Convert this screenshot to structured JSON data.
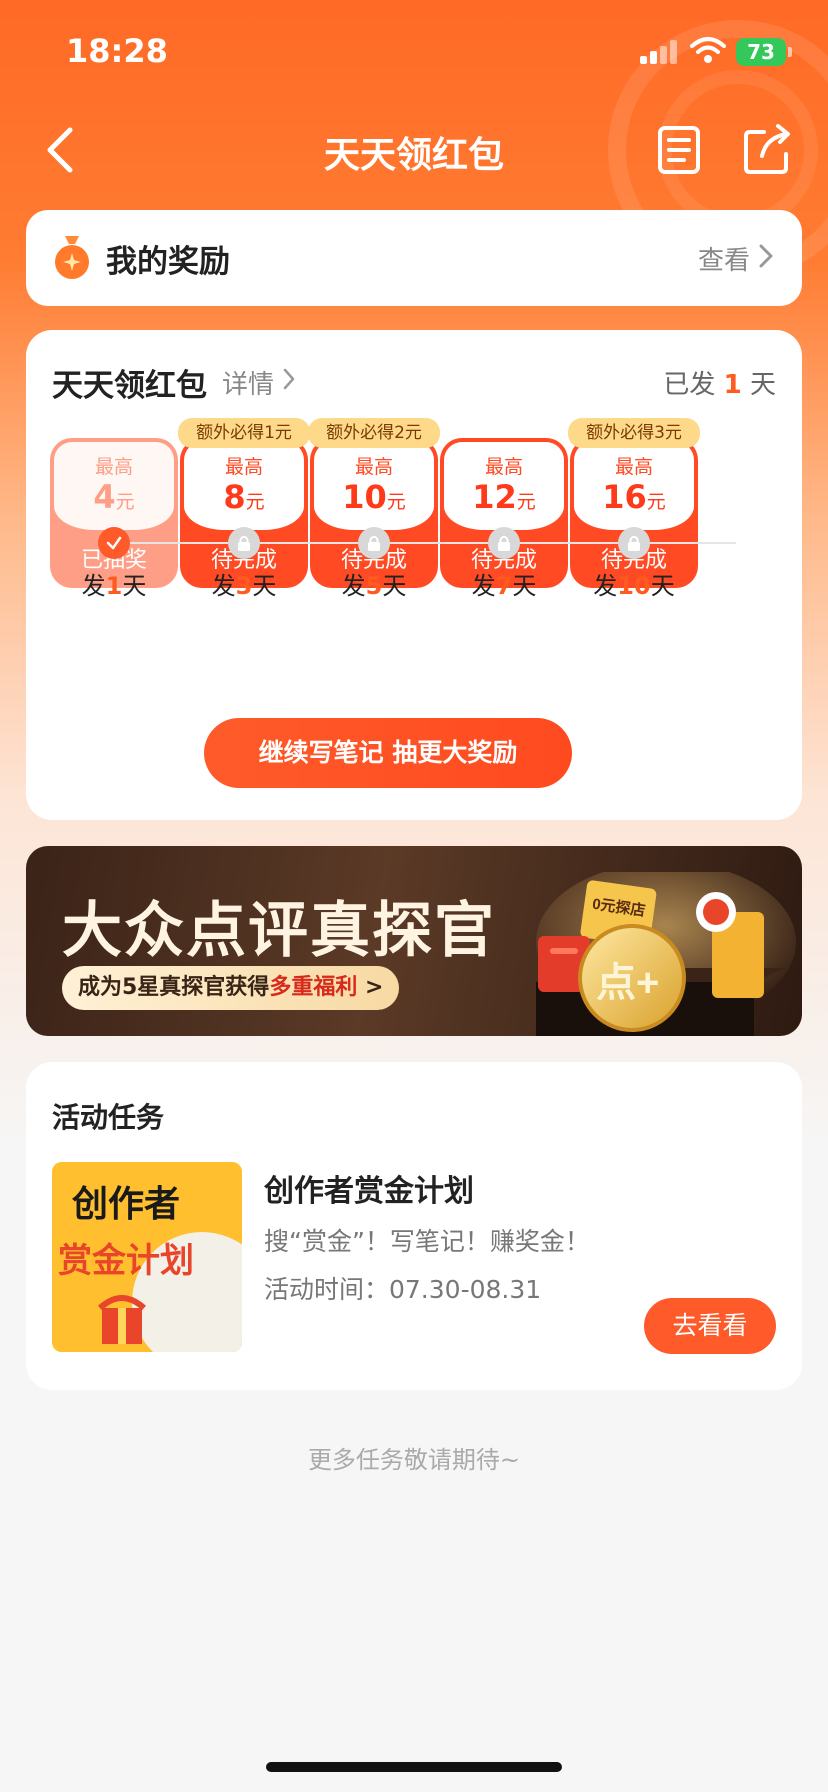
{
  "status": {
    "time": "18:28",
    "battery": "73"
  },
  "nav": {
    "title": "天天领红包"
  },
  "reward": {
    "title": "我的奖励",
    "view_label": "查看"
  },
  "packet": {
    "title": "天天领红包",
    "detail_label": "详情",
    "sent_prefix": "已发",
    "sent_days": "1",
    "sent_suffix": "天",
    "tiles": [
      {
        "badge": "",
        "max": "最高",
        "amount": "4",
        "unit": "元",
        "status": "已抽奖"
      },
      {
        "badge": "额外必得1元",
        "max": "最高",
        "amount": "8",
        "unit": "元",
        "status": "待完成"
      },
      {
        "badge": "额外必得2元",
        "max": "最高",
        "amount": "10",
        "unit": "元",
        "status": "待完成"
      },
      {
        "badge": "",
        "max": "最高",
        "amount": "12",
        "unit": "元",
        "status": "待完成"
      },
      {
        "badge": "额外必得3元",
        "max": "最高",
        "amount": "16",
        "unit": "元",
        "status": "待完成"
      }
    ],
    "days": [
      {
        "prefix": "发",
        "num": "1",
        "suffix": "天"
      },
      {
        "prefix": "发",
        "num": "3",
        "suffix": "天"
      },
      {
        "prefix": "发",
        "num": "5",
        "suffix": "天"
      },
      {
        "prefix": "发",
        "num": "7",
        "suffix": "天"
      },
      {
        "prefix": "发",
        "num": "10",
        "suffix": "天"
      }
    ],
    "cta": "继续写笔记 抽更大奖励"
  },
  "banner": {
    "title": "大众点评真探官",
    "sub_prefix": "成为5星真探官获得",
    "sub_highlight": "多重福利",
    "sub_arrow": ">",
    "art_text": "0元探店",
    "coin_text": "点+"
  },
  "tasks": {
    "heading": "活动任务",
    "items": [
      {
        "thumb_line1": "创作者",
        "thumb_line2": "赏金计划",
        "name": "创作者赏金计划",
        "desc": "搜“赏金”！写笔记！赚奖金！",
        "time": "活动时间：07.30-08.31",
        "button": "去看看"
      }
    ]
  },
  "more_tip": "更多任务敬请期待~",
  "colors": {
    "brand": "#ff5a2a",
    "accent": "#ff4a24",
    "badge": "#ffd98a"
  }
}
